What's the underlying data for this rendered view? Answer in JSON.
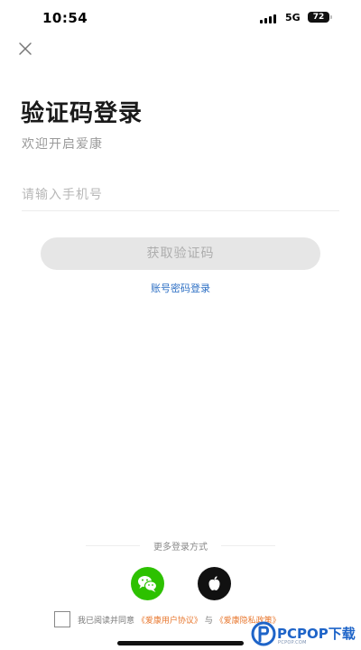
{
  "status_bar": {
    "time": "10:54",
    "network": "5G",
    "battery": "72"
  },
  "header": {
    "title": "验证码登录",
    "subtitle": "欢迎开启爱康"
  },
  "form": {
    "phone_placeholder": "请输入手机号",
    "get_code_label": "获取验证码",
    "password_login_label": "账号密码登录"
  },
  "more_login": {
    "label": "更多登录方式",
    "options": [
      {
        "name": "wechat",
        "icon": "wechat-icon",
        "color": "#2dc100"
      },
      {
        "name": "apple",
        "icon": "apple-icon",
        "color": "#111111"
      }
    ]
  },
  "agreement": {
    "prefix": "我已阅读并同意",
    "user_agreement": "《爱康用户协议》",
    "connector": "与",
    "privacy_policy": "《爱康隐私政策》"
  },
  "watermark": {
    "brand": "PCPOP下载",
    "sub": "PCPOP.COM"
  },
  "colors": {
    "accent_link": "#2d6fc4",
    "agreement_link": "#e8772e",
    "button_disabled_bg": "#e6e6e6",
    "wechat_green": "#2dc100"
  }
}
